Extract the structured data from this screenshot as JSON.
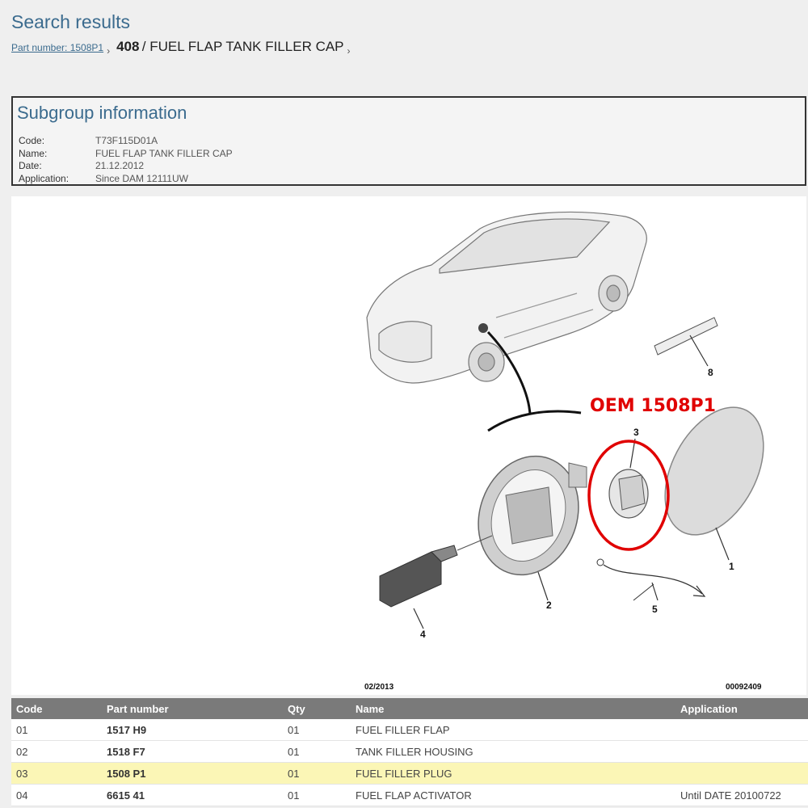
{
  "header": {
    "title": "Search results",
    "breadcrumb_link": "Part number: 1508P1",
    "sep": "›",
    "group_number": "408",
    "group_name": "/ FUEL FLAP TANK FILLER CAP"
  },
  "subgroup": {
    "title": "Subgroup information",
    "fields": [
      {
        "label": "Code:",
        "value": "T73F115D01A"
      },
      {
        "label": "Name:",
        "value": "FUEL FLAP TANK FILLER CAP"
      },
      {
        "label": "Date:",
        "value": "21.12.2012"
      },
      {
        "label": "Application:",
        "value": "Since DAM 12111UW"
      }
    ]
  },
  "diagram": {
    "annotation": "OEM 1508P1",
    "date_label": "02/2013",
    "ref_label": "00092409",
    "callouts": [
      "1",
      "2",
      "3",
      "4",
      "5",
      "8"
    ],
    "highlight_color": "#e00000"
  },
  "table": {
    "headers": [
      "Code",
      "Part number",
      "Qty",
      "Name",
      "Application"
    ],
    "rows": [
      {
        "code": "01",
        "part": "1517 H9",
        "qty": "01",
        "name": "FUEL FILLER FLAP",
        "app": ""
      },
      {
        "code": "02",
        "part": "1518 F7",
        "qty": "01",
        "name": "TANK FILLER HOUSING",
        "app": ""
      },
      {
        "code": "03",
        "part": "1508 P1",
        "qty": "01",
        "name": "FUEL FILLER PLUG",
        "app": ""
      },
      {
        "code": "04",
        "part": "6615 41",
        "qty": "01",
        "name": "FUEL FLAP ACTIVATOR",
        "app": "Until DATE 20100722"
      }
    ]
  }
}
